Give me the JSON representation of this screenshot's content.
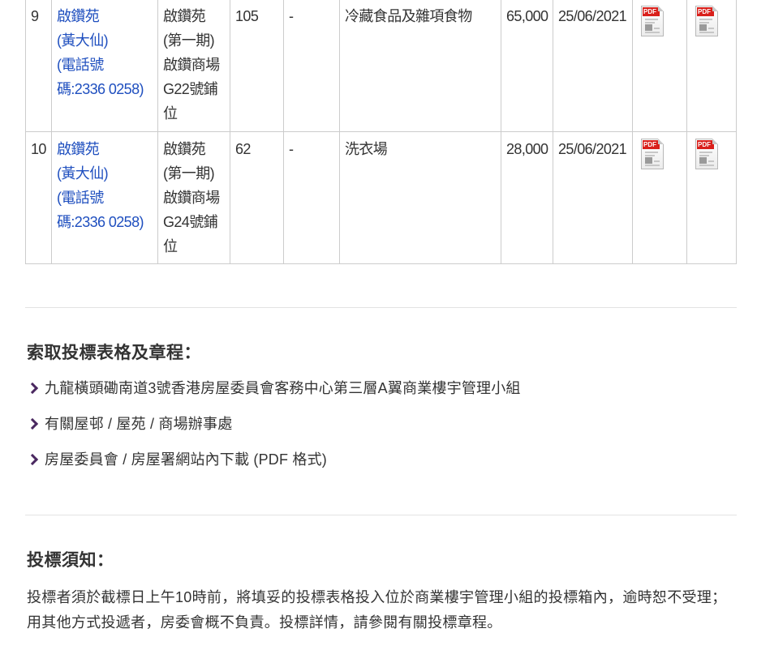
{
  "table": {
    "rows": [
      {
        "no": "9",
        "estate_lines": [
          "啟鑽苑",
          "(黃大仙)",
          "(電話號",
          "碼:2336 0258)"
        ],
        "location_lines": [
          "啟鑽苑",
          "(第一期)",
          "啟鑽商場",
          "G22號鋪",
          "位"
        ],
        "area": "105",
        "dash": "-",
        "use": "冷藏食品及雜項食物",
        "price": "65,000",
        "date": "25/06/2021",
        "pdf_label": "PDF"
      },
      {
        "no": "10",
        "estate_lines": [
          "啟鑽苑",
          "(黃大仙)",
          "(電話號",
          "碼:2336 0258)"
        ],
        "location_lines": [
          "啟鑽苑",
          "(第一期)",
          "啟鑽商場",
          "G24號鋪",
          "位"
        ],
        "area": "62",
        "dash": "-",
        "use": "洗衣場",
        "price": "28,000",
        "date": "25/06/2021",
        "pdf_label": "PDF"
      }
    ]
  },
  "obtain": {
    "title": "索取投標表格及章程：",
    "items": [
      "九龍橫頭磡南道3號香港房屋委員會客務中心第三層A翼商業樓宇管理小組",
      "有關屋邨 / 屋苑 / 商場辦事處",
      "房屋委員會 / 房屋署網站內下載 (PDF 格式)"
    ]
  },
  "notice": {
    "title": "投標須知：",
    "body": "投標者須於截標日上午10時前，將填妥的投標表格投入位於商業樓宇管理小組的投標箱內，逾時恕不受理；用其他方式投遞者，房委會概不負責。投標詳情，請參閱有關投標章程。"
  },
  "colors": {
    "link": "#1f4fbf",
    "bullet": "#4a2860",
    "pdf_tag": "#d9201b"
  }
}
